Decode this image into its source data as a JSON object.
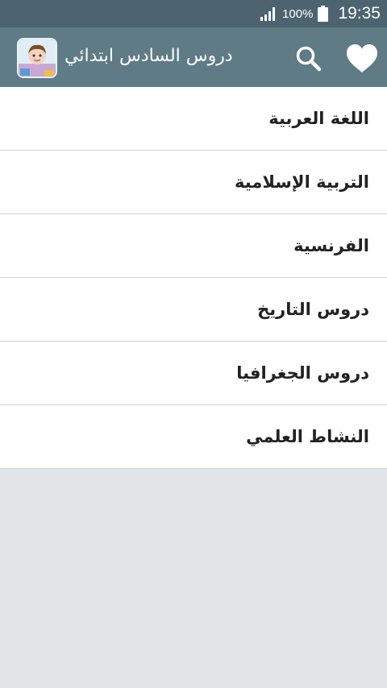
{
  "status_bar": {
    "battery_percent": "100%",
    "time": "19:35",
    "icons": [
      "signal-icon",
      "battery-icon"
    ]
  },
  "app_bar": {
    "title": "دروس السادس ابتدائي",
    "icons": [
      "app-avatar",
      "search-icon",
      "heart-icon"
    ]
  },
  "subjects": [
    {
      "label": "اللغة العربية"
    },
    {
      "label": "التربية الإسلامية"
    },
    {
      "label": "الفرنسية"
    },
    {
      "label": "دروس التاريخ"
    },
    {
      "label": "دروس الجغرافيا"
    },
    {
      "label": "النشاط العلمي"
    }
  ],
  "colors": {
    "status_bar": "#4d6470",
    "app_bar": "#5e7b86",
    "background": "#e3e6e9",
    "list_item": "#ffffff",
    "divider": "#cfd3d6"
  }
}
